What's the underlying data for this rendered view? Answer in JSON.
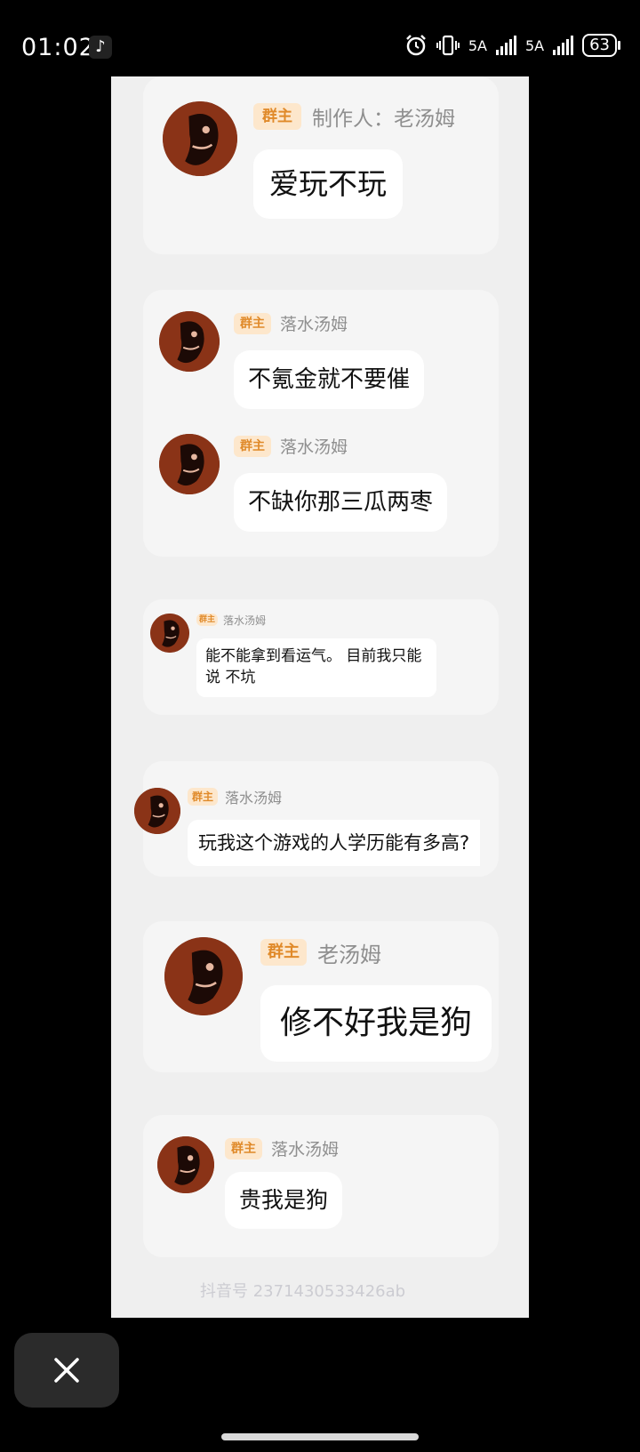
{
  "status_bar": {
    "time": "01:02",
    "app_icon": "tiktok-icon",
    "network_1": "5A",
    "network_2": "5A",
    "battery": "63"
  },
  "messages": [
    {
      "badge": "群主",
      "name": "制作人：老汤姆",
      "text": "爱玩不玩"
    },
    {
      "badge": "群主",
      "name": "落水汤姆",
      "text": "不氪金就不要催"
    },
    {
      "badge": "群主",
      "name": "落水汤姆",
      "text": "不缺你那三瓜两枣"
    },
    {
      "badge": "群主",
      "name": "落水汤姆",
      "text_line1": "能不能拿到看运气。 目前我只能",
      "text_line2": "说 不坑"
    },
    {
      "badge": "群主",
      "name": "落水汤姆",
      "text": "玩我这个游戏的人学历能有多高?"
    },
    {
      "badge": "群主",
      "name": "老汤姆",
      "text": "修不好我是狗"
    },
    {
      "badge": "群主",
      "name": "落水汤姆",
      "text": "贵我是狗"
    }
  ],
  "watermark": "抖音号 2371430533426ab",
  "icons": {
    "avatar": "avatar-illustration",
    "close": "close-icon",
    "alarm": "alarm-icon",
    "vibrate": "vibrate-icon"
  },
  "colors": {
    "badge_bg": "#fde7cc",
    "badge_text": "#e08a2a",
    "avatar_bg": "#7a2a14"
  }
}
